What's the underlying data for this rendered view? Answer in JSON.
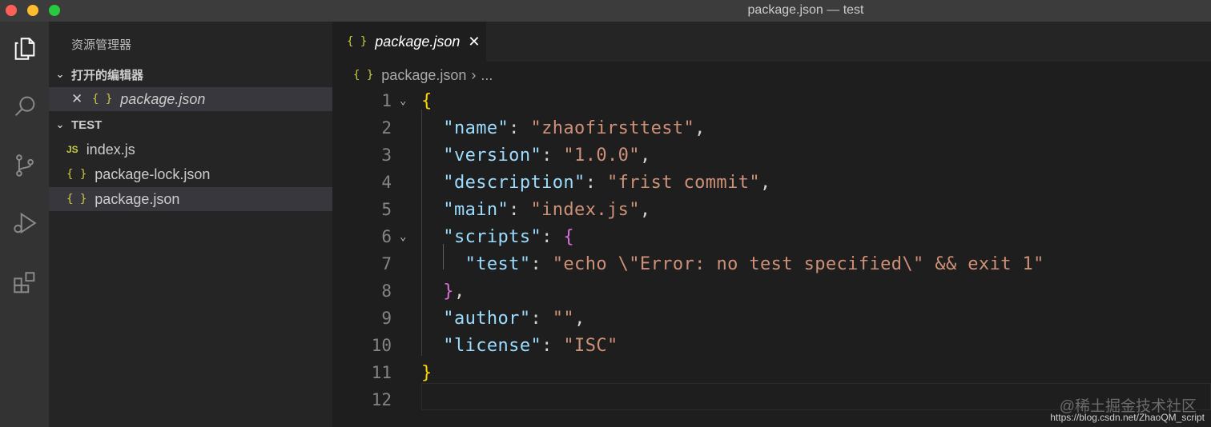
{
  "window": {
    "title": "package.json — test"
  },
  "activity_bar": {
    "items": [
      "files-icon",
      "search-icon",
      "source-control-icon",
      "run-debug-icon",
      "extensions-icon"
    ]
  },
  "sidebar": {
    "title": "资源管理器",
    "open_editors": {
      "label": "打开的编辑器",
      "items": [
        {
          "name": "package.json",
          "icon": "{ }"
        }
      ]
    },
    "workspace": {
      "label": "TEST",
      "items": [
        {
          "name": "index.js",
          "icon": "JS"
        },
        {
          "name": "package-lock.json",
          "icon": "{ }"
        },
        {
          "name": "package.json",
          "icon": "{ }"
        }
      ]
    }
  },
  "editor": {
    "tab": {
      "label": "package.json",
      "icon": "{ }"
    },
    "breadcrumb": {
      "file": "package.json",
      "rest": "..."
    },
    "lines": [
      {
        "n": "1"
      },
      {
        "n": "2",
        "key": "\"name\"",
        "value": "\"zhaofirsttest\"",
        "tail": ","
      },
      {
        "n": "3",
        "key": "\"version\"",
        "value": "\"1.0.0\"",
        "tail": ","
      },
      {
        "n": "4",
        "key": "\"description\"",
        "value": "\"frist commit\"",
        "tail": ","
      },
      {
        "n": "5",
        "key": "\"main\"",
        "value": "\"index.js\"",
        "tail": ","
      },
      {
        "n": "6",
        "key": "\"scripts\""
      },
      {
        "n": "7",
        "key": "\"test\"",
        "value": "\"echo \\\"Error: no test specified\\\" && exit 1\""
      },
      {
        "n": "8"
      },
      {
        "n": "9",
        "key": "\"author\"",
        "value": "\"\"",
        "tail": ","
      },
      {
        "n": "10",
        "key": "\"license\"",
        "value": "\"ISC\""
      },
      {
        "n": "11"
      },
      {
        "n": "12"
      }
    ]
  },
  "watermark": {
    "text": "@稀土掘金技术社区",
    "url": "https://blog.csdn.net/ZhaoQM_script"
  }
}
